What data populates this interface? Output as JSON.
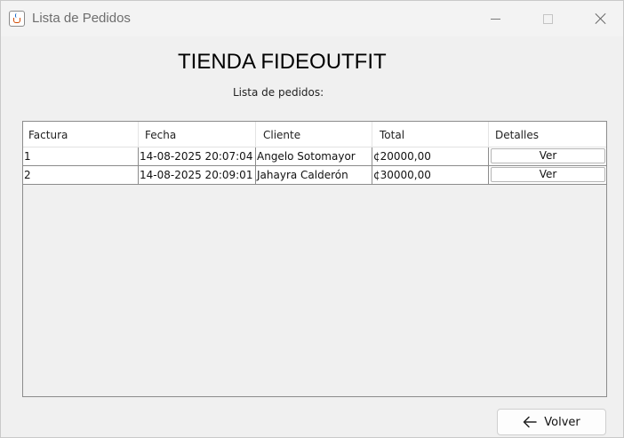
{
  "window": {
    "title": "Lista de Pedidos",
    "icon": "java-cup-icon"
  },
  "header": {
    "store_title": "TIENDA FIDEOUTFIT",
    "list_label": "Lista de pedidos:"
  },
  "table": {
    "columns": [
      "Factura",
      "Fecha",
      "Cliente",
      "Total",
      "Detalles"
    ],
    "rows": [
      [
        "1",
        "14-08-2025 20:07:04",
        "Angelo Sotomayor",
        "¢20000,00",
        "Ver"
      ],
      [
        "2",
        "14-08-2025 20:09:01",
        "Jahayra Calderón",
        "¢30000,00",
        "Ver"
      ]
    ]
  },
  "actions": {
    "volver_label": "Volver",
    "volver_icon": "arrow-left-icon"
  }
}
